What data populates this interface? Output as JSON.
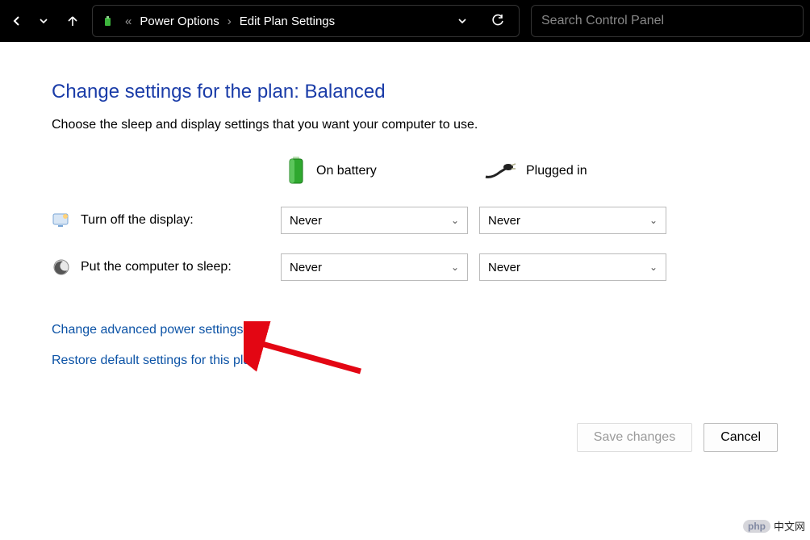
{
  "toolbar": {
    "breadcrumb_prefix": "«",
    "crumb1": "Power Options",
    "crumb_sep": "›",
    "crumb2": "Edit Plan Settings",
    "search_placeholder": "Search Control Panel"
  },
  "page": {
    "heading": "Change settings for the plan: Balanced",
    "subtext": "Choose the sleep and display settings that you want your computer to use."
  },
  "columns": {
    "battery": "On battery",
    "plugged": "Plugged in"
  },
  "rows": {
    "display": {
      "label": "Turn off the display:",
      "battery_value": "Never",
      "plugged_value": "Never"
    },
    "sleep": {
      "label": "Put the computer to sleep:",
      "battery_value": "Never",
      "plugged_value": "Never"
    }
  },
  "links": {
    "advanced": "Change advanced power settings",
    "restore": "Restore default settings for this plan"
  },
  "buttons": {
    "save": "Save changes",
    "cancel": "Cancel"
  },
  "watermark": {
    "badge": "php",
    "text": "中文网"
  }
}
